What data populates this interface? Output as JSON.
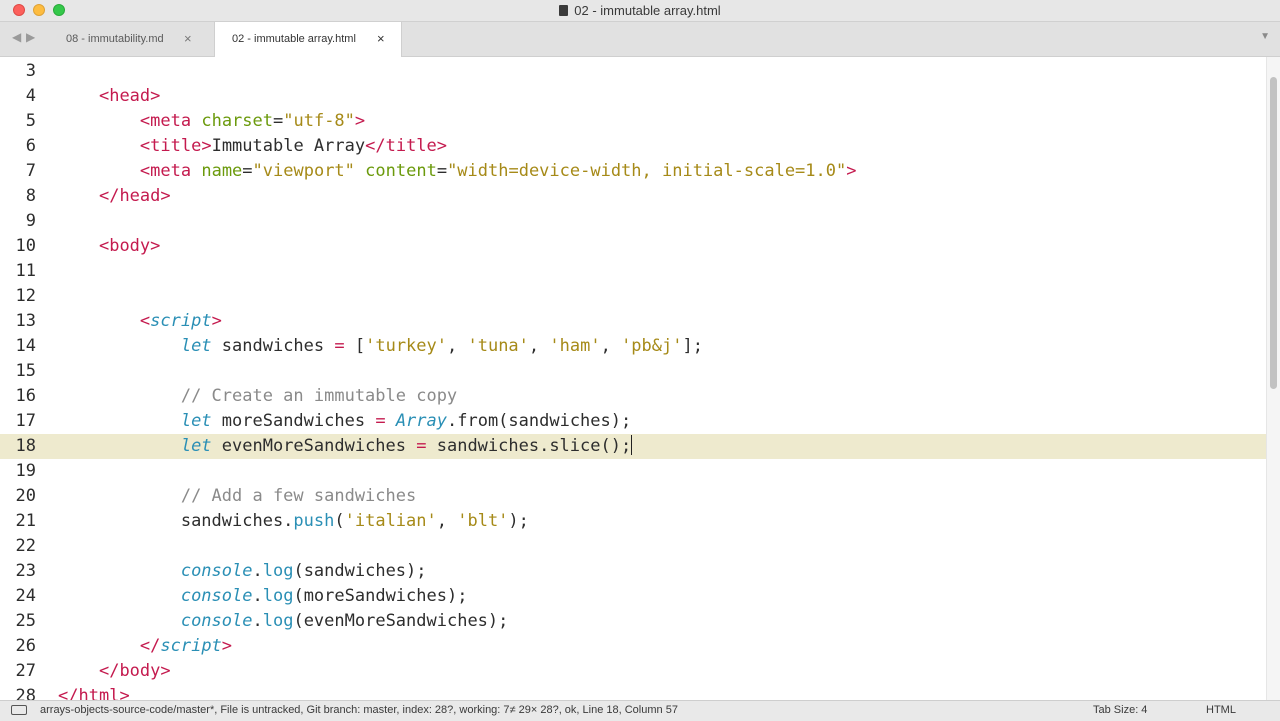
{
  "window": {
    "title": "02 - immutable array.html"
  },
  "tabs": [
    {
      "label": "08 - immutability.md",
      "close": "×",
      "active": false
    },
    {
      "label": "02 - immutable array.html",
      "close": "×",
      "active": true
    }
  ],
  "nav": {
    "back": "◀",
    "forward": "▶",
    "menu": "▼"
  },
  "editor": {
    "active_line": 18,
    "lines": [
      {
        "n": "3",
        "tokens": []
      },
      {
        "n": "4",
        "tokens": [
          [
            "    ",
            ""
          ],
          [
            "<",
            "tag"
          ],
          [
            "head",
            "tag"
          ],
          [
            ">",
            "tag"
          ]
        ]
      },
      {
        "n": "5",
        "tokens": [
          [
            "        ",
            ""
          ],
          [
            "<",
            "tag"
          ],
          [
            "meta",
            "tag"
          ],
          [
            " ",
            ""
          ],
          [
            "charset",
            "attr"
          ],
          [
            "=",
            ""
          ],
          [
            "\"utf-8\"",
            "str"
          ],
          [
            ">",
            "tag"
          ]
        ]
      },
      {
        "n": "6",
        "tokens": [
          [
            "        ",
            ""
          ],
          [
            "<",
            "tag"
          ],
          [
            "title",
            "tag"
          ],
          [
            ">",
            "tag"
          ],
          [
            "Immutable Array",
            ""
          ],
          [
            "</",
            "tag"
          ],
          [
            "title",
            "tag"
          ],
          [
            ">",
            "tag"
          ]
        ]
      },
      {
        "n": "7",
        "tokens": [
          [
            "        ",
            ""
          ],
          [
            "<",
            "tag"
          ],
          [
            "meta",
            "tag"
          ],
          [
            " ",
            ""
          ],
          [
            "name",
            "attr"
          ],
          [
            "=",
            ""
          ],
          [
            "\"viewport\"",
            "str"
          ],
          [
            " ",
            ""
          ],
          [
            "content",
            "attr"
          ],
          [
            "=",
            ""
          ],
          [
            "\"width=device-width, initial-scale=1.0\"",
            "str"
          ],
          [
            ">",
            "tag"
          ]
        ]
      },
      {
        "n": "8",
        "tokens": [
          [
            "    ",
            ""
          ],
          [
            "</",
            "tag"
          ],
          [
            "head",
            "tag"
          ],
          [
            ">",
            "tag"
          ]
        ]
      },
      {
        "n": "9",
        "tokens": []
      },
      {
        "n": "10",
        "tokens": [
          [
            "    ",
            ""
          ],
          [
            "<",
            "tag"
          ],
          [
            "body",
            "tag"
          ],
          [
            ">",
            "tag"
          ]
        ]
      },
      {
        "n": "11",
        "tokens": []
      },
      {
        "n": "12",
        "tokens": []
      },
      {
        "n": "13",
        "tokens": [
          [
            "        ",
            ""
          ],
          [
            "<",
            "tag"
          ],
          [
            "script",
            "tag kw"
          ],
          [
            ">",
            "tag"
          ]
        ]
      },
      {
        "n": "14",
        "tokens": [
          [
            "            ",
            ""
          ],
          [
            "let",
            "kw"
          ],
          [
            " sandwiches ",
            ""
          ],
          [
            "=",
            "tag"
          ],
          [
            " [",
            ""
          ],
          [
            "'turkey'",
            "str"
          ],
          [
            ", ",
            ""
          ],
          [
            "'tuna'",
            "str"
          ],
          [
            ", ",
            ""
          ],
          [
            "'ham'",
            "str"
          ],
          [
            ", ",
            ""
          ],
          [
            "'pb&j'",
            "str"
          ],
          [
            "];",
            ""
          ]
        ]
      },
      {
        "n": "15",
        "tokens": []
      },
      {
        "n": "16",
        "tokens": [
          [
            "            ",
            ""
          ],
          [
            "// Create an immutable copy",
            "com"
          ]
        ]
      },
      {
        "n": "17",
        "tokens": [
          [
            "            ",
            ""
          ],
          [
            "let",
            "kw"
          ],
          [
            " moreSandwiches ",
            ""
          ],
          [
            "=",
            "tag"
          ],
          [
            " ",
            ""
          ],
          [
            "Array",
            "cls"
          ],
          [
            ".from(sandwiches);",
            ""
          ]
        ]
      },
      {
        "n": "18",
        "tokens": [
          [
            "            ",
            ""
          ],
          [
            "let",
            "kw"
          ],
          [
            " evenMoreSandwiches ",
            ""
          ],
          [
            "=",
            "tag"
          ],
          [
            " sandwiches.slice();",
            ""
          ]
        ]
      },
      {
        "n": "19",
        "tokens": []
      },
      {
        "n": "20",
        "tokens": [
          [
            "            ",
            ""
          ],
          [
            "// Add a few sandwiches",
            "com"
          ]
        ]
      },
      {
        "n": "21",
        "tokens": [
          [
            "            ",
            ""
          ],
          [
            "sandwiches.",
            ""
          ],
          [
            "push",
            "fn"
          ],
          [
            "(",
            ""
          ],
          [
            "'italian'",
            "str"
          ],
          [
            ", ",
            ""
          ],
          [
            "'blt'",
            "str"
          ],
          [
            ");",
            ""
          ]
        ]
      },
      {
        "n": "22",
        "tokens": []
      },
      {
        "n": "23",
        "tokens": [
          [
            "            ",
            ""
          ],
          [
            "console",
            "kw"
          ],
          [
            ".",
            ""
          ],
          [
            "log",
            "fn"
          ],
          [
            "(sandwiches);",
            ""
          ]
        ]
      },
      {
        "n": "24",
        "tokens": [
          [
            "            ",
            ""
          ],
          [
            "console",
            "kw"
          ],
          [
            ".",
            ""
          ],
          [
            "log",
            "fn"
          ],
          [
            "(moreSandwiches);",
            ""
          ]
        ]
      },
      {
        "n": "25",
        "tokens": [
          [
            "            ",
            ""
          ],
          [
            "console",
            "kw"
          ],
          [
            ".",
            ""
          ],
          [
            "log",
            "fn"
          ],
          [
            "(evenMoreSandwiches);",
            ""
          ]
        ]
      },
      {
        "n": "26",
        "tokens": [
          [
            "        ",
            ""
          ],
          [
            "</",
            "tag"
          ],
          [
            "script",
            "tag kw"
          ],
          [
            ">",
            "tag"
          ]
        ]
      },
      {
        "n": "27",
        "tokens": [
          [
            "    ",
            ""
          ],
          [
            "</",
            "tag"
          ],
          [
            "body",
            "tag"
          ],
          [
            ">",
            "tag"
          ]
        ]
      },
      {
        "n": "28",
        "tokens": [
          [
            "",
            ""
          ],
          [
            "</",
            "tag"
          ],
          [
            "html",
            "tag"
          ],
          [
            ">",
            "tag"
          ]
        ]
      }
    ]
  },
  "statusbar": {
    "text": "arrays-objects-source-code/master*, File is untracked, Git branch: master, index: 28?, working: 7≠ 29× 28?, ok, Line 18, Column 57",
    "tab_size": "Tab Size: 4",
    "syntax": "HTML"
  },
  "colors": {
    "tag": "#c41a4e",
    "attr": "#6b9a0c",
    "string": "#a68a18",
    "keyword": "#2a8fb5",
    "comment": "#8a8a8a",
    "active_line": "#eeeace"
  }
}
